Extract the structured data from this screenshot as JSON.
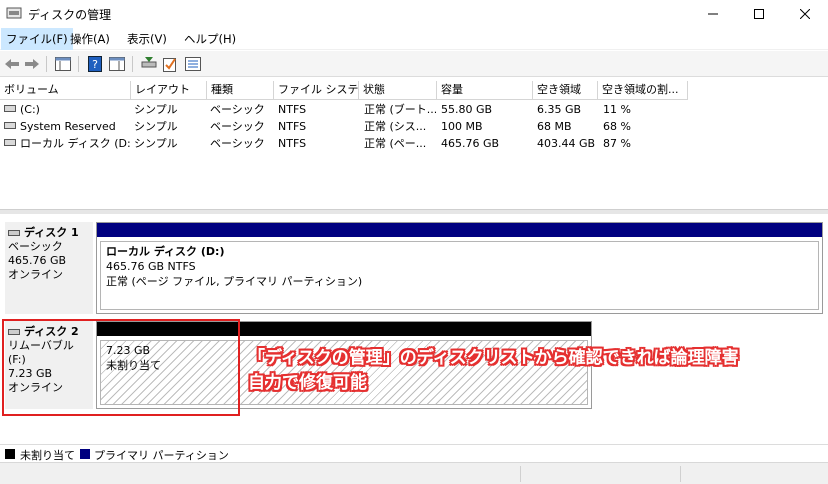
{
  "window": {
    "title": "ディスクの管理"
  },
  "menu": [
    {
      "label": "ファイル(F)"
    },
    {
      "label": "操作(A)"
    },
    {
      "label": "表示(V)"
    },
    {
      "label": "ヘルプ(H)"
    }
  ],
  "columns": [
    "ボリューム",
    "レイアウト",
    "種類",
    "ファイル システム",
    "状態",
    "容量",
    "空き領域",
    "空き領域の割..."
  ],
  "volumes": [
    {
      "name": "(C:)",
      "layout": "シンプル",
      "type": "ベーシック",
      "fs": "NTFS",
      "status": "正常 (ブート...",
      "capacity": "55.80 GB",
      "free": "6.35 GB",
      "free_pct": "11 %"
    },
    {
      "name": "System Reserved",
      "layout": "シンプル",
      "type": "ベーシック",
      "fs": "NTFS",
      "status": "正常 (シス...",
      "capacity": "100 MB",
      "free": "68 MB",
      "free_pct": "68 %"
    },
    {
      "name": "ローカル ディスク (D:)",
      "layout": "シンプル",
      "type": "ベーシック",
      "fs": "NTFS",
      "status": "正常 (ペー...",
      "capacity": "465.76 GB",
      "free": "403.44 GB",
      "free_pct": "87 %"
    }
  ],
  "disks": [
    {
      "name": "ディスク 1",
      "kind": "ベーシック",
      "size": "465.76 GB",
      "state": "オンライン",
      "partition": {
        "title": "ローカル ディスク (D:)",
        "size_fs": "465.76 GB NTFS",
        "status": "正常 (ページ ファイル, プライマリ パーティション)"
      }
    },
    {
      "name": "ディスク 2",
      "kind": "リムーバブル (F:)",
      "size": "7.23 GB",
      "state": "オンライン",
      "partition": {
        "size": "7.23 GB",
        "status": "未割り当て"
      }
    }
  ],
  "annotation": {
    "line1": "「ディスクの管理」のディスクリストから確認できれば論理障害",
    "line2": "自力で修復可能"
  },
  "legend": [
    {
      "label": "未割り当て",
      "color": "#000000"
    },
    {
      "label": "プライマリ パーティション",
      "color": "#000080"
    }
  ],
  "colors": {
    "primary_partition": "#000080",
    "unallocated": "#000000",
    "highlight": "#e02020"
  }
}
